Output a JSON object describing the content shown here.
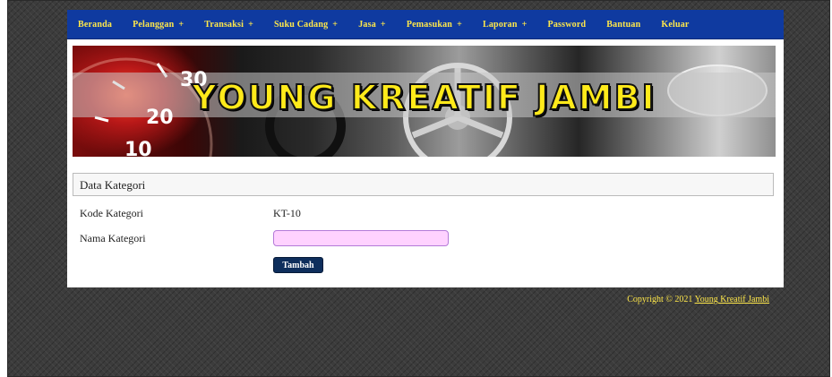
{
  "nav": {
    "items": [
      {
        "label": "Beranda",
        "plus": ""
      },
      {
        "label": "Pelanggan",
        "plus": "+"
      },
      {
        "label": "Transaksi",
        "plus": "+"
      },
      {
        "label": "Suku Cadang",
        "plus": "+"
      },
      {
        "label": "Jasa",
        "plus": "+"
      },
      {
        "label": "Pemasukan",
        "plus": "+"
      },
      {
        "label": "Laporan",
        "plus": "+"
      },
      {
        "label": "Password",
        "plus": ""
      },
      {
        "label": "Bantuan",
        "plus": ""
      },
      {
        "label": "Keluar",
        "plus": ""
      }
    ]
  },
  "banner": {
    "title": "YOUNG KREATIF JAMBI",
    "gauge_numbers": [
      "30",
      "20",
      "10"
    ]
  },
  "panel": {
    "title": "Data Kategori"
  },
  "form": {
    "kode_label": "Kode Kategori",
    "kode_value": "KT-10",
    "nama_label": "Nama Kategori",
    "nama_value": "",
    "submit_label": "Tambah"
  },
  "footer": {
    "text": "Copyright © 2021",
    "link": "Young Kreatif Jambi"
  },
  "colors": {
    "nav_bg": "#0f3aa0",
    "nav_text": "#ffe84a",
    "input_bg": "#ffd2ff",
    "button_bg": "#0e2e5c"
  }
}
